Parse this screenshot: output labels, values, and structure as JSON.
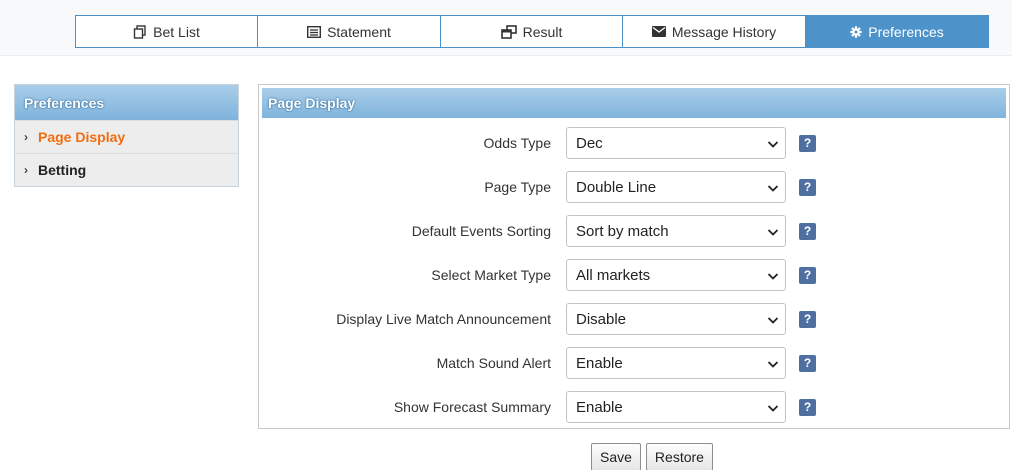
{
  "tabs": [
    {
      "label": "Bet List",
      "icon": "copy-icon"
    },
    {
      "label": "Statement",
      "icon": "list-icon"
    },
    {
      "label": "Result",
      "icon": "windows-icon"
    },
    {
      "label": "Message History",
      "icon": "envelope-icon"
    },
    {
      "label": "Preferences",
      "icon": "gear-icon",
      "active": true
    }
  ],
  "sidebar": {
    "title": "Preferences",
    "items": [
      {
        "label": "Page Display",
        "active": true
      },
      {
        "label": "Betting"
      }
    ]
  },
  "panel": {
    "title": "Page Display",
    "rows": [
      {
        "label": "Odds Type",
        "value": "Dec"
      },
      {
        "label": "Page Type",
        "value": "Double Line"
      },
      {
        "label": "Default Events Sorting",
        "value": "Sort by match"
      },
      {
        "label": "Select Market Type",
        "value": "All markets"
      },
      {
        "label": "Display Live Match Announcement",
        "value": "Disable"
      },
      {
        "label": "Match Sound Alert",
        "value": "Enable"
      },
      {
        "label": "Show Forecast Summary",
        "value": "Enable"
      }
    ],
    "help_glyph": "?"
  },
  "actions": {
    "save_label": "Save",
    "restore_label": "Restore"
  },
  "colors": {
    "accent": "#4d93c9",
    "active_item": "#f26d0f",
    "help_badge": "#4f6fa0"
  }
}
